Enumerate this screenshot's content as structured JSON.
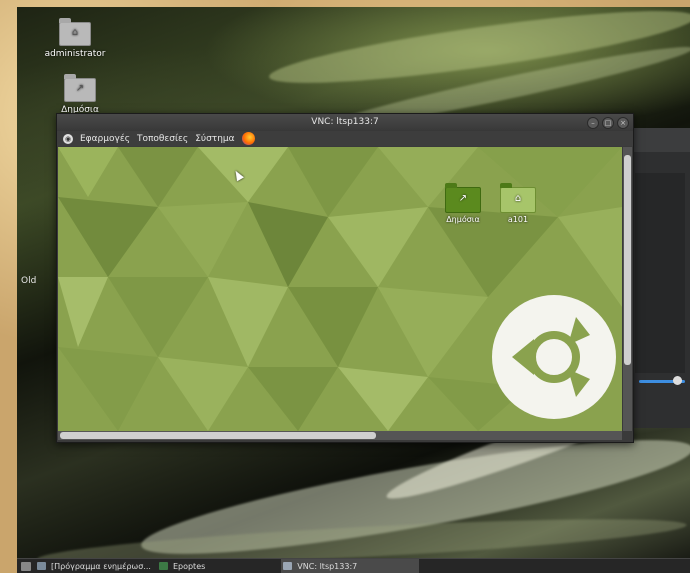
{
  "desktop": {
    "icons": [
      {
        "label": "administrator",
        "icon": "home-folder-icon"
      },
      {
        "label": "Δημόσια",
        "icon": "shared-folder-icon"
      }
    ],
    "side_label": "Old"
  },
  "vnc_window": {
    "title": "VNC: ltsp133:7",
    "menu": {
      "applications": "Εφαρμογές",
      "places": "Τοποθεσίες",
      "system": "Σύστημα"
    },
    "remote_icons": [
      {
        "label": "Δημόσια",
        "icon": "shared-folder-icon"
      },
      {
        "label": "a101",
        "icon": "home-folder-icon"
      }
    ]
  },
  "taskbar": {
    "items": [
      {
        "label": "[Πρόγραμμα ενημέρωσ...",
        "icon": "update-icon"
      },
      {
        "label": "Epoptes",
        "icon": "epoptes-icon"
      },
      {
        "label": "VNC: ltsp133:7",
        "icon": "vnc-icon",
        "active": true
      }
    ]
  },
  "colors": {
    "remote_wallpaper": "#8aa24e",
    "taskbar": "#262626",
    "accent": "#3d8ee0"
  }
}
